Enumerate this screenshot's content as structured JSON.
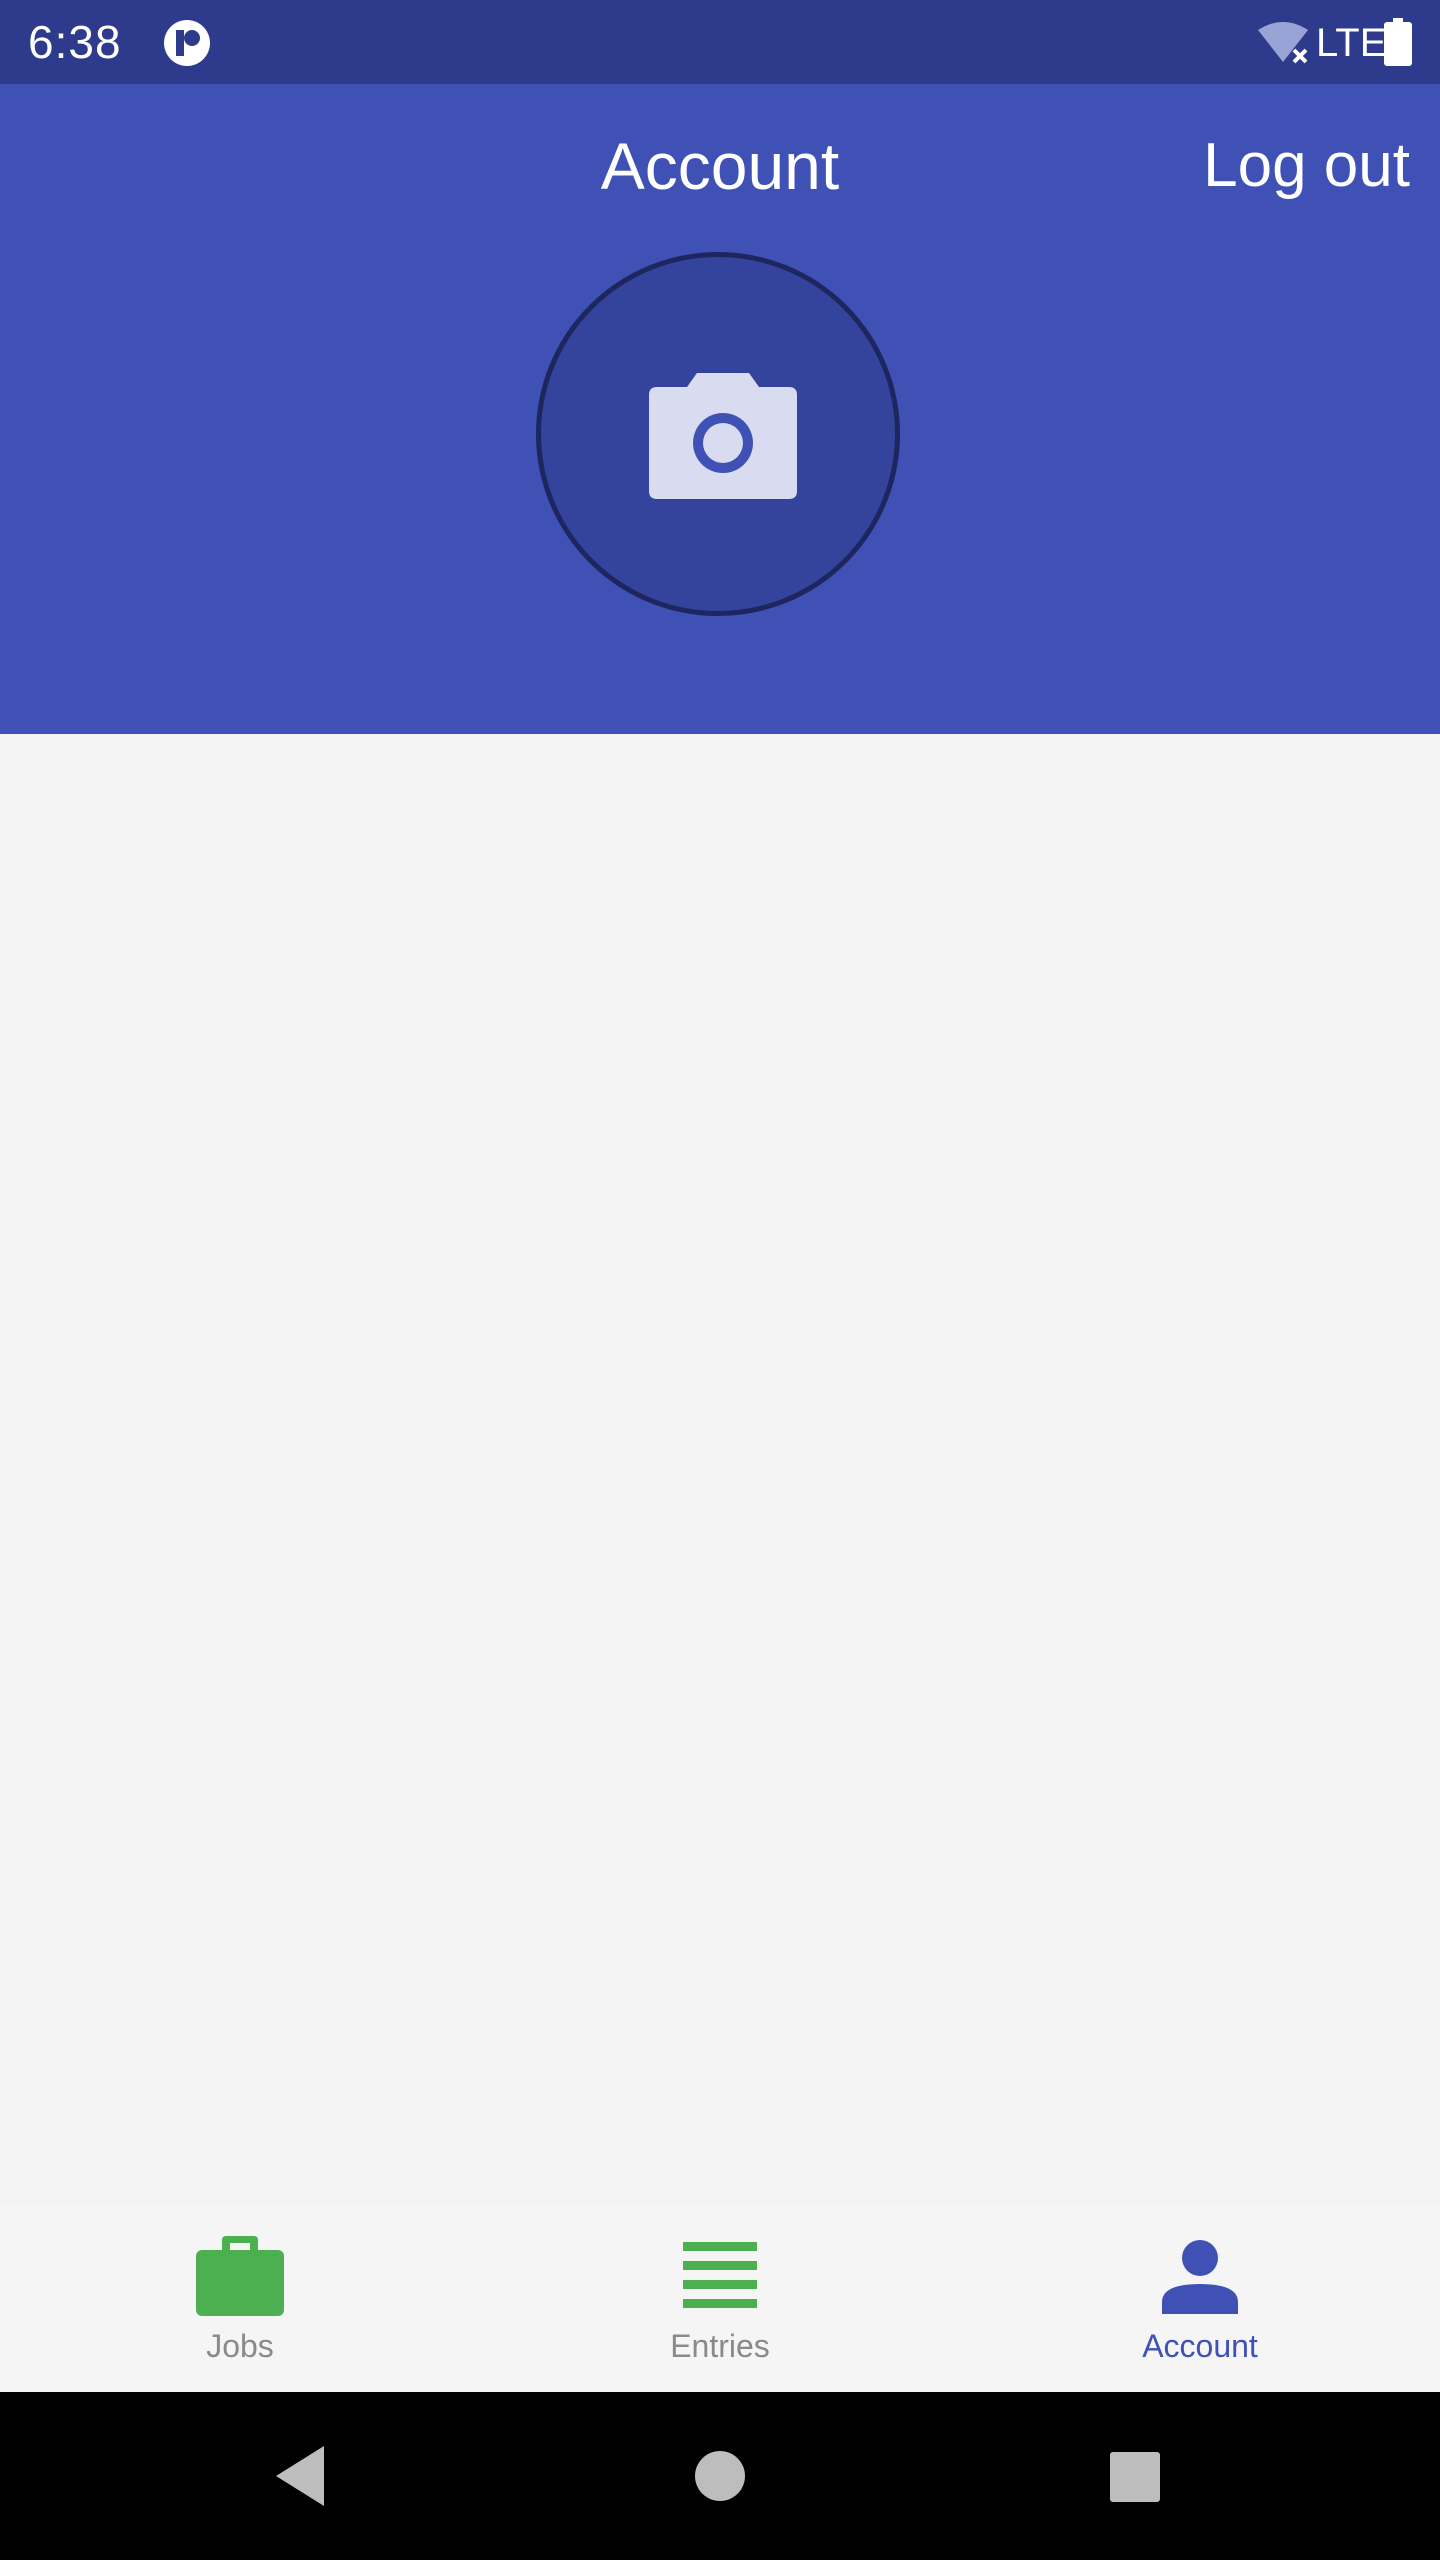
{
  "status_bar": {
    "time": "6:38",
    "network": "LTE",
    "icons": [
      "app-notification-icon",
      "wifi-off-icon",
      "battery-icon"
    ]
  },
  "app_bar": {
    "title": "Account",
    "logout_label": "Log out",
    "avatar_icon": "camera-icon"
  },
  "bottom_nav": {
    "items": [
      {
        "label": "Jobs",
        "icon": "briefcase-icon",
        "color": "#4caf50",
        "label_color": "#8a8a8a"
      },
      {
        "label": "Entries",
        "icon": "list-icon",
        "color": "#4caf50",
        "label_color": "#8a8a8a"
      },
      {
        "label": "Account",
        "icon": "person-icon",
        "color": "#3f51b5",
        "label_color": "#3f51b5",
        "selected": true
      }
    ]
  },
  "system_nav": {
    "buttons": [
      "back-icon",
      "home-icon",
      "recents-icon"
    ]
  },
  "colors": {
    "primary": "#3f51b5",
    "status_bar": "#2e3b8c",
    "accent_green": "#4caf50",
    "background": "#f3f3f3"
  }
}
